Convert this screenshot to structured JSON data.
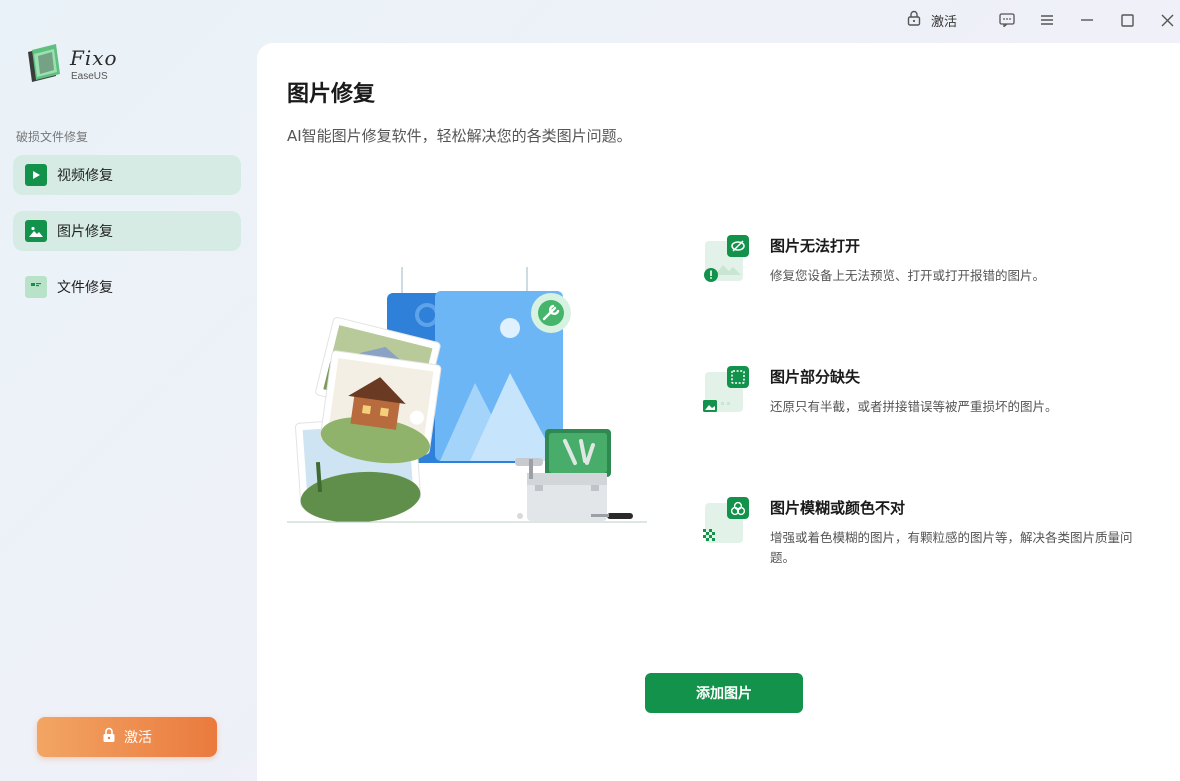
{
  "window": {
    "activate_label": "激活",
    "controls": [
      "feedback-icon",
      "menu-icon",
      "minimize-icon",
      "maximize-icon",
      "close-icon"
    ]
  },
  "app": {
    "name": "Fixo",
    "brand": "EaseUS"
  },
  "sidebar": {
    "section_label": "破损文件修复",
    "items": [
      {
        "label": "视频修复",
        "icon": "video-icon"
      },
      {
        "label": "图片修复",
        "icon": "image-icon"
      },
      {
        "label": "文件修复",
        "icon": "document-icon"
      }
    ],
    "activate_label": "激活"
  },
  "main": {
    "title": "图片修复",
    "subtitle": "AI智能图片修复软件，轻松解决您的各类图片问题。",
    "features": [
      {
        "title": "图片无法打开",
        "desc": "修复您设备上无法预览、打开或打开报错的图片。",
        "icon": "broken-image-icon"
      },
      {
        "title": "图片部分缺失",
        "desc": "还原只有半截，或者拼接错误等被严重损坏的图片。",
        "icon": "partial-image-icon"
      },
      {
        "title": "图片模糊或颜色不对",
        "desc": "增强或着色模糊的图片，有颗粒感的图片等，解决各类图片质量问题。",
        "icon": "blur-image-icon"
      }
    ],
    "add_button_label": "添加图片"
  },
  "colors": {
    "accent": "#13924c",
    "activate_start": "#f2a564",
    "activate_end": "#ea7a3e",
    "nav_active_bg": "#cee8dd"
  }
}
